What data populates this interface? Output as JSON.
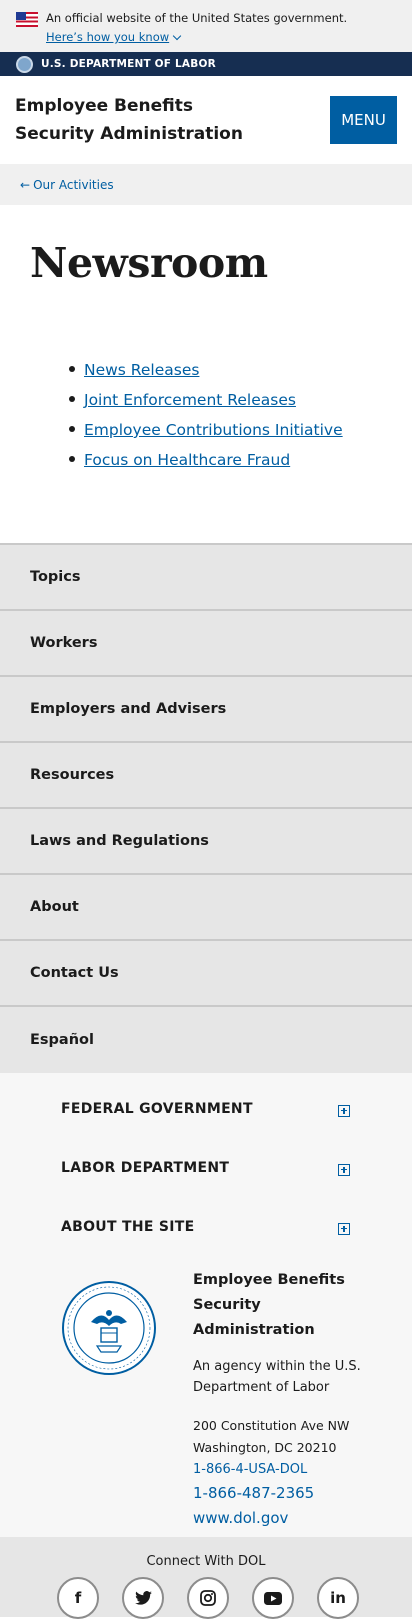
{
  "gov_banner": {
    "text": "An official website of the United States government.",
    "link": "Here’s how you know"
  },
  "dol_bar": {
    "label": "U.S. DEPARTMENT OF LABOR"
  },
  "header": {
    "title": "Employee Benefits Security Administration",
    "menu_label": "MENU"
  },
  "breadcrumb": {
    "label": "Our Activities"
  },
  "main": {
    "title": "Newsroom",
    "links": [
      "News Releases",
      "Joint Enforcement Releases",
      "Employee Contributions Initiative",
      "Focus on Healthcare Fraud"
    ]
  },
  "nav": {
    "items": [
      "Topics",
      "Workers",
      "Employers and Advisers",
      "Resources",
      "Laws and Regulations",
      "About",
      "Contact Us",
      "Español"
    ]
  },
  "footer": {
    "accordions": [
      "FEDERAL GOVERNMENT",
      "LABOR DEPARTMENT",
      "ABOUT THE SITE"
    ],
    "agency_name": "Employee Benefits Security Administration",
    "agency_desc": "An agency within the U.S. Department of Labor",
    "address_line1": "200 Constitution Ave NW",
    "address_line2": "Washington, DC 20210",
    "phone1": "1-866-4-USA-DOL",
    "phone2": "1-866-487-2365",
    "website": "www.dol.gov",
    "connect_label": "Connect With DOL",
    "social": [
      {
        "icon": "facebook-icon",
        "glyph": "f"
      },
      {
        "icon": "twitter-icon",
        "glyph": "🐦"
      },
      {
        "icon": "instagram-icon",
        "glyph": "◎"
      },
      {
        "icon": "youtube-icon",
        "glyph": "▶"
      },
      {
        "icon": "linkedin-icon",
        "glyph": "in"
      }
    ]
  },
  "colors": {
    "link": "#005ea2",
    "dol_bar": "#162e51",
    "nav_bg": "#e6e6e6"
  }
}
